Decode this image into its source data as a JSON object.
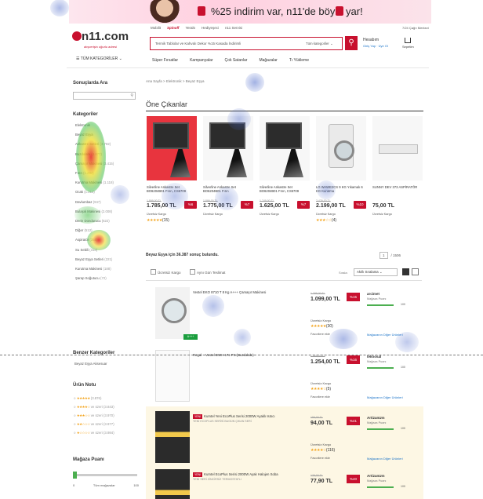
{
  "banner": {
    "text": "%25 indirim var, n11'de böyle yar!"
  },
  "header": {
    "logo": "n11.com",
    "tagline": "alışverişin uğurlu adresi",
    "categories_button": "TÜM KATEGORİLER",
    "sites": [
      "Mobilit",
      "Spinoff",
      "Yeraltı",
      "Hediyeşeci",
      "n11 Servisi"
    ],
    "search_placeholder": "Termik Tablolar ve Kahvalı Dekor %15 Kasada İndirimli",
    "search_category": "Tüm kategoriler",
    "help": "7/24 Çağrı Merkezi",
    "user_name": "Hesabım",
    "user_links": "Giriş Yap · Üye Ol",
    "cart": "Sepetim",
    "nav": [
      "Süper Fırsatlar",
      "Kampanyalar",
      "Çok Satanlar",
      "Mağazalar",
      "Tı Yükleme"
    ]
  },
  "sidebar": {
    "search_title": "Sonuçlarda Ara",
    "categories_title": "Kategoriler",
    "categories": [
      {
        "label": "Elektronik",
        "count": ""
      },
      {
        "label": "Beyaz Eşya",
        "count": ""
      },
      {
        "label": "Ankastre Setleri",
        "count": "(3.782)"
      },
      {
        "label": "Buzdolabı",
        "count": "(4.877)"
      },
      {
        "label": "Çamaşır Makinesi",
        "count": "(3.415)"
      },
      {
        "label": "Fırın",
        "count": "(1.284)"
      },
      {
        "label": "Kurutma Makinesi",
        "count": "(1.118)"
      },
      {
        "label": "Ocak",
        "count": "(1.213)"
      },
      {
        "label": "Davlumbaz",
        "count": "(947)"
      },
      {
        "label": "Bulaşık Makinesi",
        "count": "(2.008)"
      },
      {
        "label": "Derin Dondurucu",
        "count": "(622)"
      },
      {
        "label": "Diğer",
        "count": "(512)"
      },
      {
        "label": "Aspiratör",
        "count": "(355)"
      },
      {
        "label": "Su Sebili",
        "count": "(318)"
      },
      {
        "label": "Beyaz Eşya Setleri",
        "count": "(221)"
      },
      {
        "label": "Kurutma Makinesi",
        "count": "(188)"
      },
      {
        "label": "Şarap Soğutucu",
        "count": "(72)"
      }
    ],
    "similar_title": "Benzer Kategoriler",
    "similar_item": "Beyaz Eşya Aksesuar",
    "rating_title": "Ürün Notu",
    "ratings": [
      {
        "stars": "★★★★★",
        "count": "(3.876)"
      },
      {
        "stars": "★★★★☆",
        "count": "ve üzeri (3.843)"
      },
      {
        "stars": "★★★☆☆",
        "count": "ve üzeri (3.970)"
      },
      {
        "stars": "★★☆☆☆",
        "count": "ve üzeri (3.977)"
      },
      {
        "stars": "★☆☆☆☆",
        "count": "ve üzeri (3.984)"
      }
    ],
    "store_title": "Mağaza Puanı",
    "store_min": "0",
    "store_max": "100",
    "store_label": "Tüm mağazalar"
  },
  "main": {
    "breadcrumb": "Ana Sayfa > Elektronik > Beyaz Eşya",
    "section_title": "Öne Çıkanlar",
    "featured": [
      {
        "name": "Silverline Ankastre Set BO6204B01 Fırın, CS6709",
        "old": "1.899,00 TL",
        "price": "1.785,00 TL",
        "discount": "%6",
        "shipping": "Ücretsiz Kargo",
        "stars": "★★★★★",
        "reviews": "(15)"
      },
      {
        "name": "Silverline Ankastre Set BO6204B01 Fırın",
        "old": "1.899,00 TL",
        "price": "1.775,00 TL",
        "discount": "%7",
        "shipping": "Ücretsiz Kargo",
        "stars": "",
        "reviews": ""
      },
      {
        "name": "Silverline Ankastre Set BO6204B01 Fırın, CS5709",
        "old": "1.749,00 TL",
        "price": "1.625,00 TL",
        "discount": "%7",
        "shipping": "Ücretsiz Kargo",
        "stars": "",
        "reviews": ""
      },
      {
        "name": "LG WAWE2CS 9 KG Yıkamalı 6 KG Kurutma",
        "old": "2.429,00 TL",
        "price": "2.199,00 TL",
        "discount": "%10",
        "shipping": "Ücretsiz Kargo",
        "stars": "★★★☆☆",
        "reviews": "(4)"
      },
      {
        "name": "SUNNY DEV 373 ASPİRATÖR",
        "old": "",
        "price": "75,00 TL",
        "discount": "",
        "shipping": "Ücretsiz Kargo",
        "stars": "",
        "reviews": ""
      }
    ],
    "result_count": "Beyaz Eşya için 36.387 sonuç bulundu.",
    "page_current": "1",
    "page_total": "/ 1506",
    "filter_free_shipping": "Ücretsiz Kargo",
    "filter_same_day": "Aynı Gün Teslimat",
    "sort_label": "Sırala:",
    "sort_value": "Akıllı Sıralama",
    "results": [
      {
        "title": "Vestel EKO 8710 T 8 Kg A+++ Çamaşır Makinesi",
        "tag": "",
        "sub": "",
        "old": "1.299,00 TL",
        "price": "1.099,00 TL",
        "discount": "%15",
        "shipping": "Ücretsiz Kargo",
        "stars": "★★★★★",
        "reviews": "(30)",
        "fav": "Favorilere ekle",
        "seller": "arcimet",
        "seller_sub": "Mağaza Puanı",
        "score": "100",
        "other": "Mağazanın Diğer Ürünleri"
      },
      {
        "title": "Regal – Vestel DWH 171 PS (Buzdolabı)",
        "tag": "",
        "sub": "",
        "old": "1.499,00 TL",
        "price": "1.254,00 TL",
        "discount": "%16",
        "shipping": "Ücretsiz Kargo",
        "stars": "★★★★☆",
        "reviews": "(5)",
        "fav": "Favorilere ekle",
        "seller": "teknosal",
        "seller_sub": "Mağaza Puanı",
        "score": "100",
        "other": "Mağazanın Diğer Ürünleri"
      },
      {
        "title": "Kumtel Yeni EcoPlus Serisi 2000W Ayaklı Isıtıcı",
        "tag": "YENİ",
        "sub": "YENİ ECOPLUS SERİSİ BUGÜN ÇIKAN SERİ",
        "old": "159,00 TL",
        "price": "94,00 TL",
        "discount": "%41",
        "shipping": "Ücretsiz Kargo",
        "stars": "★★★★☆",
        "reviews": "(116)",
        "fav": "Favorilere ekle",
        "seller": "ArtizanUm",
        "seller_sub": "Mağaza Puanı",
        "score": "100",
        "other": "Mağazanın Diğer Ürünleri"
      },
      {
        "title": "Kumtel EcoPlus Serisi 2000W Ayak Halojen Soba",
        "tag": "YENİ",
        "sub": "YENİ SERİ ZİNCİRSİZ TERMOSTATLI",
        "old": "129,00 TL",
        "price": "77,90 TL",
        "discount": "%40",
        "shipping": "",
        "stars": "",
        "reviews": "",
        "fav": "",
        "seller": "ArtizanUm",
        "seller_sub": "Mağaza Puanı",
        "score": "100",
        "other": ""
      }
    ]
  },
  "colors": {
    "brand_red": "#c8102e",
    "link_blue": "#1a73c8",
    "seller_bar": "#4caf50"
  }
}
